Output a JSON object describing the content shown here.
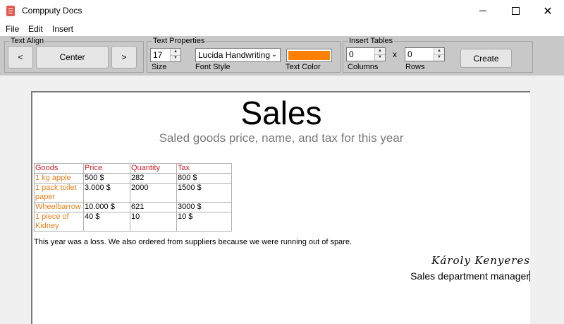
{
  "window": {
    "title": "Compputy Docs",
    "icon": "document-icon"
  },
  "menu": [
    "File",
    "Edit",
    "Insert"
  ],
  "toolbar": {
    "text_align": {
      "label": "Text Align",
      "left": "<",
      "center": "Center",
      "right": ">"
    },
    "text_properties": {
      "label": "Text Properties",
      "size": "17",
      "size_label": "Size",
      "font": "Lucida Handwriting",
      "font_label": "Font Style",
      "color_label": "Text Color",
      "color": "#ff8000"
    },
    "insert_tables": {
      "label": "Insert Tables",
      "columns": "0",
      "columns_label": "Columns",
      "x": "x",
      "rows": "0",
      "rows_label": "Rows",
      "create": "Create"
    }
  },
  "document": {
    "title": "Sales",
    "subtitle": "Saled goods price, name, and tax for this year",
    "table": {
      "headers": [
        "Goods",
        "Price",
        "Quantity",
        "Tax"
      ],
      "rows": [
        [
          "1 kg apple",
          "500 $",
          "282",
          "800 $"
        ],
        [
          "1 pack toilet paper",
          "3.000 $",
          "2000",
          "1500 $"
        ],
        [
          "Wheelbarrow",
          "10.000 $",
          "621",
          "3000 $"
        ],
        [
          "1 piece of Kidney",
          "40 $",
          "10",
          "10 $"
        ]
      ]
    },
    "paragraph": "This year was a loss. We also ordered from suppliers because we were running out of spare.",
    "signature": "Károly Kenyeres",
    "role": "Sales department manager"
  }
}
